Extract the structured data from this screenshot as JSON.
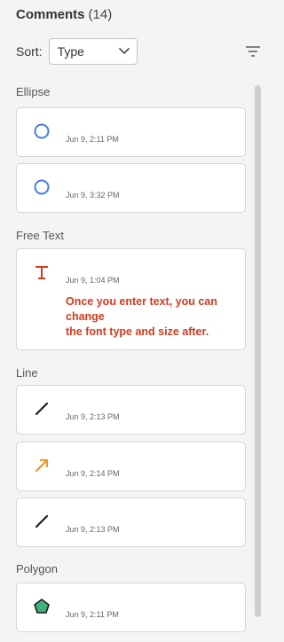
{
  "panel": {
    "title": "Comments",
    "count": "(14)"
  },
  "sort": {
    "label": "Sort:",
    "selected": "Type"
  },
  "icons": {
    "filter": "filter-lines-icon",
    "dropdown": "chevron-down-icon"
  },
  "sections": [
    {
      "label": "Ellipse",
      "items": [
        {
          "icon": "ellipse-icon",
          "time": "Jun 9, 2:11 PM"
        },
        {
          "icon": "ellipse-icon",
          "time": "Jun 9, 3:32 PM"
        }
      ]
    },
    {
      "label": "Free Text",
      "items": [
        {
          "icon": "free-text-icon",
          "time": "Jun 9, 1:04 PM",
          "text": "Once you enter text, you can change\nthe font type and size after."
        }
      ]
    },
    {
      "label": "Line",
      "items": [
        {
          "icon": "line-icon",
          "time": "Jun 9, 2:13 PM"
        },
        {
          "icon": "arrow-icon",
          "time": "Jun 9, 2:14 PM"
        },
        {
          "icon": "line-icon",
          "time": "Jun 9, 2:13 PM"
        }
      ]
    },
    {
      "label": "Polygon",
      "items": [
        {
          "icon": "polygon-icon",
          "time": "Jun 9, 2:11 PM"
        }
      ]
    }
  ],
  "colors": {
    "ellipse": "#4a7ae0",
    "free_text": "#d33a1e",
    "line": "#1f1f1f",
    "arrow": "#f0952d",
    "polygon_fill": "#3fb17a",
    "polygon_stroke": "#1f1f1f"
  }
}
